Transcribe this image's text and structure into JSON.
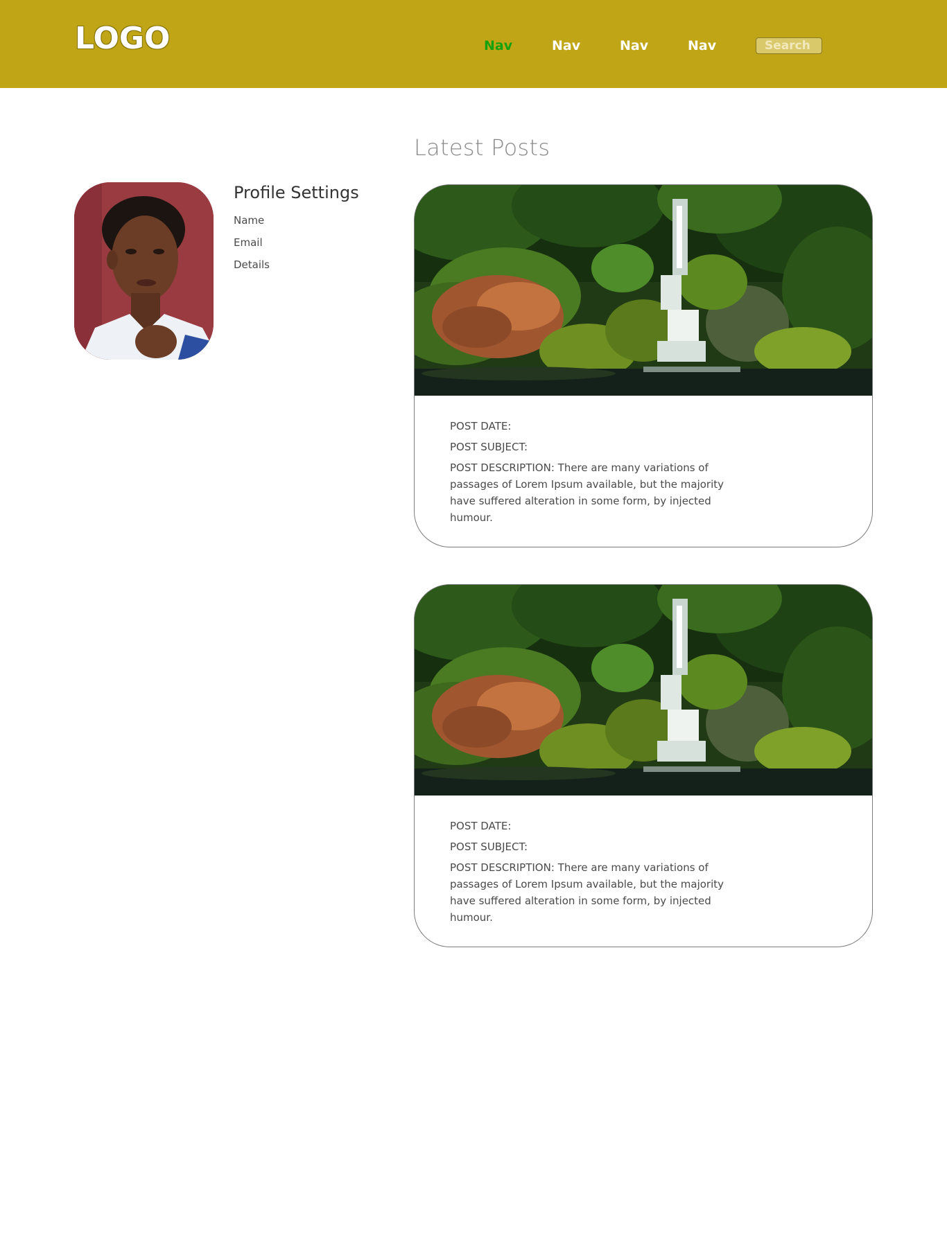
{
  "header": {
    "logo": "LOGO",
    "nav": [
      {
        "label": "Nav",
        "active": true
      },
      {
        "label": "Nav",
        "active": false
      },
      {
        "label": "Nav",
        "active": false
      },
      {
        "label": "Nav",
        "active": false
      }
    ],
    "search": {
      "placeholder": "Search",
      "value": ""
    }
  },
  "colors": {
    "header_bg": "#c0a616",
    "nav_active": "#16a10e",
    "nav_text": "#ffffff"
  },
  "profile": {
    "title": "Profile Settings",
    "links": [
      "Name",
      "Email",
      "Details"
    ]
  },
  "posts_section": {
    "title": "Latest Posts",
    "posts": [
      {
        "date_label": "POST DATE:",
        "subject_label": "POST SUBJECT:",
        "description": "POST DESCRIPTION: There are many variations of passages of Lorem Ipsum available, but the majority have suffered alteration in some form, by injected humour."
      },
      {
        "date_label": "POST DATE:",
        "subject_label": "POST SUBJECT:",
        "description": "POST DESCRIPTION: There are many variations of passages of Lorem Ipsum available, but the majority have suffered alteration in some form, by injected humour."
      }
    ]
  }
}
